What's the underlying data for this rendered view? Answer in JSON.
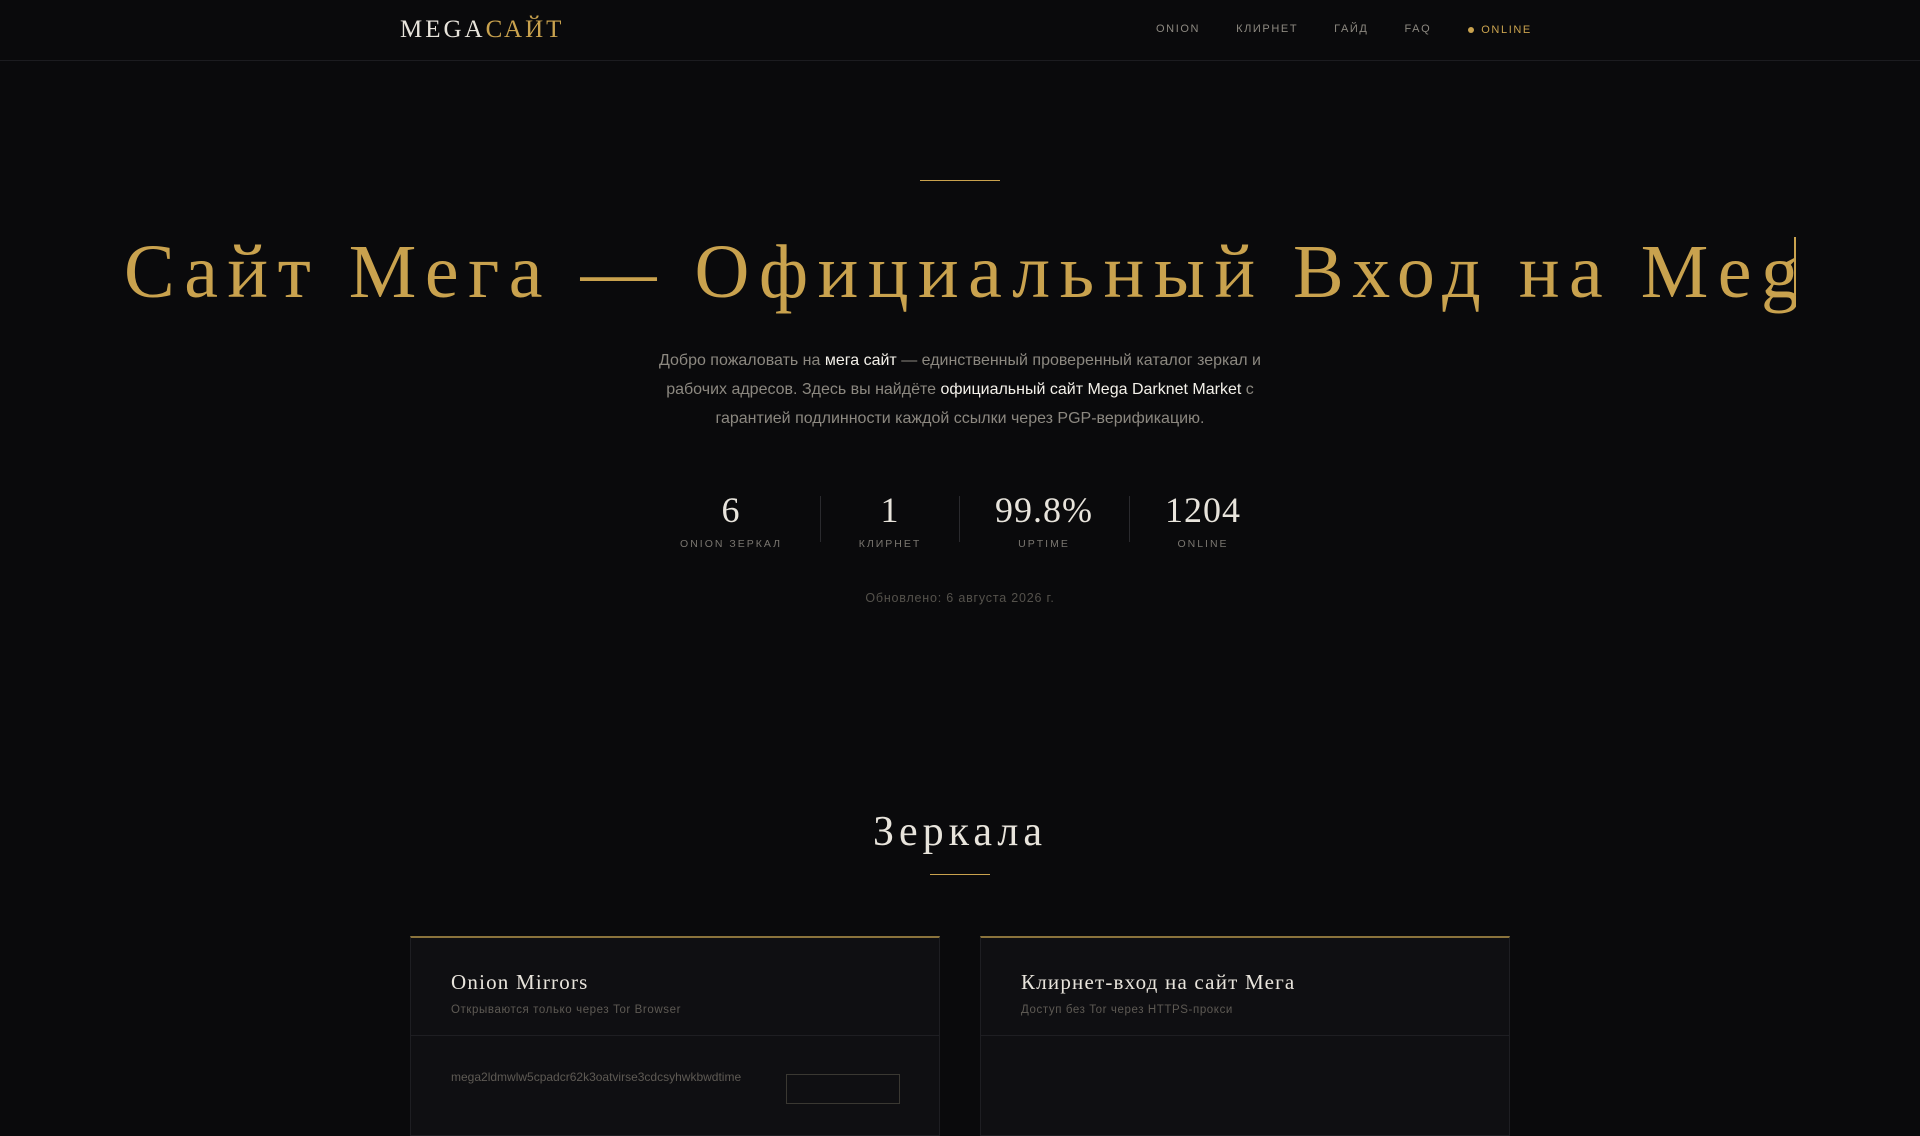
{
  "header": {
    "logo_part1": "MEGA",
    "logo_part2": "САЙТ",
    "nav": [
      "ONION",
      "КЛИРНЕТ",
      "ГАЙД",
      "FAQ"
    ],
    "status": "ONLINE"
  },
  "hero": {
    "title": "Сайт Мега — Официальный Вход на Mega Darknet Market",
    "desc": {
      "p1": "Добро пожаловать на ",
      "b1": "мега сайт",
      "p2": " — единственный проверенный каталог зеркал и рабочих адресов. Здесь вы найдёте ",
      "b2": "официальный сайт Mega Darknet Market",
      "p3": " с гарантией подлинности каждой ссылки через PGP-верификацию."
    }
  },
  "stats": [
    {
      "value": "6",
      "label": "ONION ЗЕРКАЛ"
    },
    {
      "value": "1",
      "label": "КЛИРНЕТ"
    },
    {
      "value": "99.8%",
      "label": "UPTIME"
    },
    {
      "value": "1204",
      "label": "ONLINE"
    }
  ],
  "updated": "Обновлено: 6 августа 2026 г.",
  "mirrors": {
    "title": "Зеркала",
    "cards": [
      {
        "title": "Onion Mirrors",
        "sub": "Открываются только через Tor Browser",
        "first_row": "mega2ldmwlw5cpadcr62k3oatvirse3cdcsyhwkbwdtime"
      },
      {
        "title": "Клирнет-вход на сайт Мега",
        "sub": "Доступ без Tor через HTTPS-прокси",
        "first_row": ""
      }
    ]
  },
  "colors": {
    "background": "#0a0a0c",
    "accent_gold": "#c9a24e",
    "text_light": "#e8e4dc",
    "text_muted": "#8c8880"
  }
}
